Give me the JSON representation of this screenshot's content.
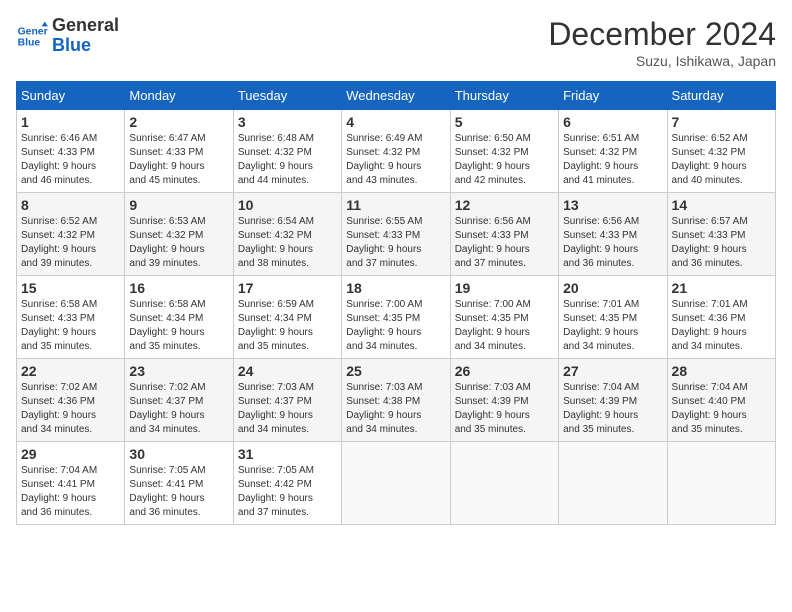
{
  "logo": {
    "line1": "General",
    "line2": "Blue"
  },
  "title": "December 2024",
  "subtitle": "Suzu, Ishikawa, Japan",
  "weekdays": [
    "Sunday",
    "Monday",
    "Tuesday",
    "Wednesday",
    "Thursday",
    "Friday",
    "Saturday"
  ],
  "weeks": [
    [
      {
        "day": "1",
        "info": "Sunrise: 6:46 AM\nSunset: 4:33 PM\nDaylight: 9 hours\nand 46 minutes."
      },
      {
        "day": "2",
        "info": "Sunrise: 6:47 AM\nSunset: 4:33 PM\nDaylight: 9 hours\nand 45 minutes."
      },
      {
        "day": "3",
        "info": "Sunrise: 6:48 AM\nSunset: 4:32 PM\nDaylight: 9 hours\nand 44 minutes."
      },
      {
        "day": "4",
        "info": "Sunrise: 6:49 AM\nSunset: 4:32 PM\nDaylight: 9 hours\nand 43 minutes."
      },
      {
        "day": "5",
        "info": "Sunrise: 6:50 AM\nSunset: 4:32 PM\nDaylight: 9 hours\nand 42 minutes."
      },
      {
        "day": "6",
        "info": "Sunrise: 6:51 AM\nSunset: 4:32 PM\nDaylight: 9 hours\nand 41 minutes."
      },
      {
        "day": "7",
        "info": "Sunrise: 6:52 AM\nSunset: 4:32 PM\nDaylight: 9 hours\nand 40 minutes."
      }
    ],
    [
      {
        "day": "8",
        "info": "Sunrise: 6:52 AM\nSunset: 4:32 PM\nDaylight: 9 hours\nand 39 minutes."
      },
      {
        "day": "9",
        "info": "Sunrise: 6:53 AM\nSunset: 4:32 PM\nDaylight: 9 hours\nand 39 minutes."
      },
      {
        "day": "10",
        "info": "Sunrise: 6:54 AM\nSunset: 4:32 PM\nDaylight: 9 hours\nand 38 minutes."
      },
      {
        "day": "11",
        "info": "Sunrise: 6:55 AM\nSunset: 4:33 PM\nDaylight: 9 hours\nand 37 minutes."
      },
      {
        "day": "12",
        "info": "Sunrise: 6:56 AM\nSunset: 4:33 PM\nDaylight: 9 hours\nand 37 minutes."
      },
      {
        "day": "13",
        "info": "Sunrise: 6:56 AM\nSunset: 4:33 PM\nDaylight: 9 hours\nand 36 minutes."
      },
      {
        "day": "14",
        "info": "Sunrise: 6:57 AM\nSunset: 4:33 PM\nDaylight: 9 hours\nand 36 minutes."
      }
    ],
    [
      {
        "day": "15",
        "info": "Sunrise: 6:58 AM\nSunset: 4:33 PM\nDaylight: 9 hours\nand 35 minutes."
      },
      {
        "day": "16",
        "info": "Sunrise: 6:58 AM\nSunset: 4:34 PM\nDaylight: 9 hours\nand 35 minutes."
      },
      {
        "day": "17",
        "info": "Sunrise: 6:59 AM\nSunset: 4:34 PM\nDaylight: 9 hours\nand 35 minutes."
      },
      {
        "day": "18",
        "info": "Sunrise: 7:00 AM\nSunset: 4:35 PM\nDaylight: 9 hours\nand 34 minutes."
      },
      {
        "day": "19",
        "info": "Sunrise: 7:00 AM\nSunset: 4:35 PM\nDaylight: 9 hours\nand 34 minutes."
      },
      {
        "day": "20",
        "info": "Sunrise: 7:01 AM\nSunset: 4:35 PM\nDaylight: 9 hours\nand 34 minutes."
      },
      {
        "day": "21",
        "info": "Sunrise: 7:01 AM\nSunset: 4:36 PM\nDaylight: 9 hours\nand 34 minutes."
      }
    ],
    [
      {
        "day": "22",
        "info": "Sunrise: 7:02 AM\nSunset: 4:36 PM\nDaylight: 9 hours\nand 34 minutes."
      },
      {
        "day": "23",
        "info": "Sunrise: 7:02 AM\nSunset: 4:37 PM\nDaylight: 9 hours\nand 34 minutes."
      },
      {
        "day": "24",
        "info": "Sunrise: 7:03 AM\nSunset: 4:37 PM\nDaylight: 9 hours\nand 34 minutes."
      },
      {
        "day": "25",
        "info": "Sunrise: 7:03 AM\nSunset: 4:38 PM\nDaylight: 9 hours\nand 34 minutes."
      },
      {
        "day": "26",
        "info": "Sunrise: 7:03 AM\nSunset: 4:39 PM\nDaylight: 9 hours\nand 35 minutes."
      },
      {
        "day": "27",
        "info": "Sunrise: 7:04 AM\nSunset: 4:39 PM\nDaylight: 9 hours\nand 35 minutes."
      },
      {
        "day": "28",
        "info": "Sunrise: 7:04 AM\nSunset: 4:40 PM\nDaylight: 9 hours\nand 35 minutes."
      }
    ],
    [
      {
        "day": "29",
        "info": "Sunrise: 7:04 AM\nSunset: 4:41 PM\nDaylight: 9 hours\nand 36 minutes."
      },
      {
        "day": "30",
        "info": "Sunrise: 7:05 AM\nSunset: 4:41 PM\nDaylight: 9 hours\nand 36 minutes."
      },
      {
        "day": "31",
        "info": "Sunrise: 7:05 AM\nSunset: 4:42 PM\nDaylight: 9 hours\nand 37 minutes."
      },
      null,
      null,
      null,
      null
    ]
  ]
}
